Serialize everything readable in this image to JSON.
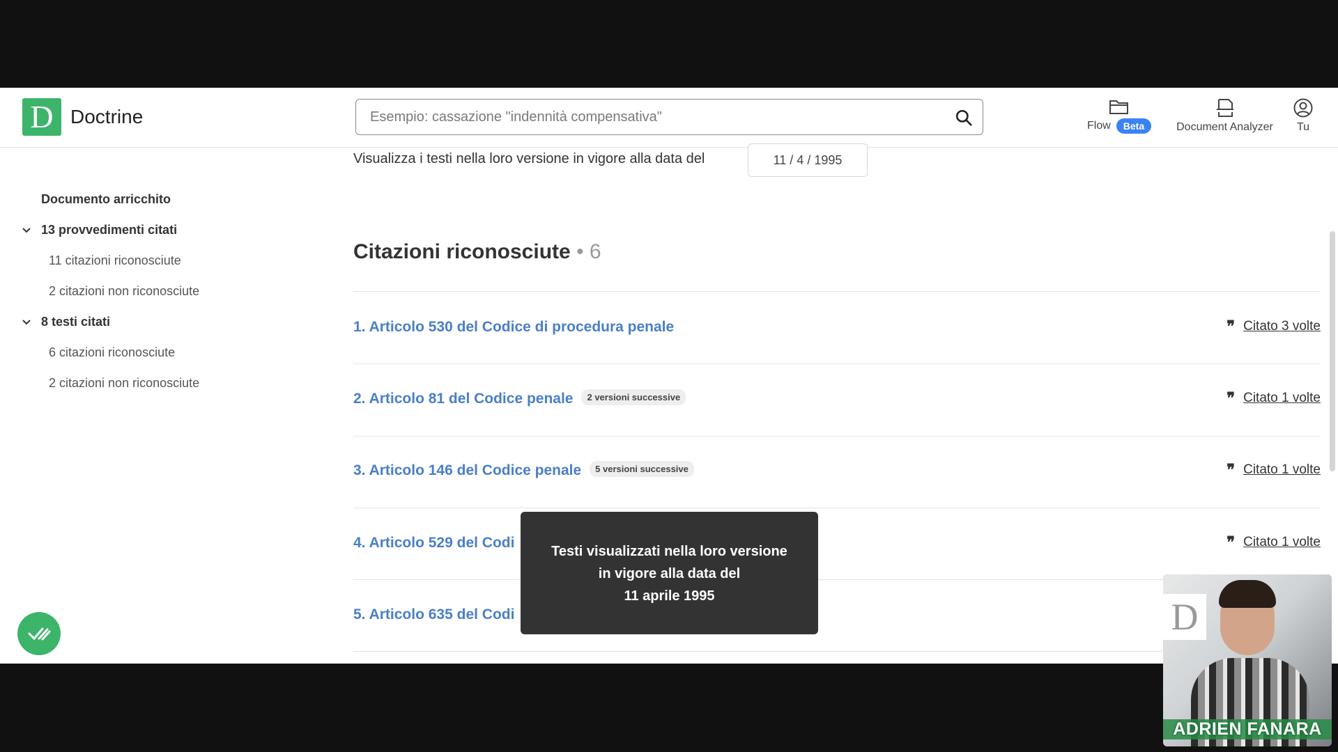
{
  "header": {
    "brand_letter": "D",
    "brand_name": "Doctrine",
    "search_placeholder": "Esempio: cassazione \"indennità compensativa\"",
    "nav": {
      "flow_label": "Flow",
      "beta_label": "Beta",
      "analyzer_label": "Document Analyzer",
      "profile_label": "Tu"
    }
  },
  "sidebar": {
    "title": "Documento arricchito",
    "groups": [
      {
        "label": "13 provvedimenti citati",
        "items": [
          "11 citazioni riconosciute",
          "2 citazioni non riconosciute"
        ]
      },
      {
        "label": "8 testi citati",
        "items": [
          "6 citazioni riconosciute",
          "2 citazioni non riconosciute"
        ]
      }
    ]
  },
  "main": {
    "date_label": "Visualizza i testi nella loro versione in vigore alla data del",
    "date_value": "11  /  4  /  1995",
    "section_title": "Citazioni riconosciute",
    "section_count": "• 6",
    "citations": [
      {
        "label": "1. Articolo 530 del Codice di procedura penale",
        "badge": "",
        "cited": "Citato 3 volte"
      },
      {
        "label": "2. Articolo 81 del Codice penale",
        "badge": "2 versioni successive",
        "cited": "Citato 1 volte"
      },
      {
        "label": "3. Articolo 146 del Codice penale",
        "badge": "5 versioni successive",
        "cited": "Citato 1 volte"
      },
      {
        "label": "4. Articolo 529 del Codi",
        "badge": "",
        "cited": "Citato 1 volte"
      },
      {
        "label": "5. Articolo 635 del Codi",
        "badge": "",
        "cited": ""
      }
    ]
  },
  "tooltip": {
    "line1": "Testi visualizzati nella loro versione",
    "line2": "in vigore alla data del",
    "line3": "11 aprile 1995"
  },
  "webcam": {
    "presenter_name": "ADRIEN FANARA"
  },
  "colors": {
    "brand_green": "#3cb56a",
    "link_blue": "#4a7fc8",
    "beta_blue": "#3b82f6",
    "tooltip_bg": "#333333"
  }
}
